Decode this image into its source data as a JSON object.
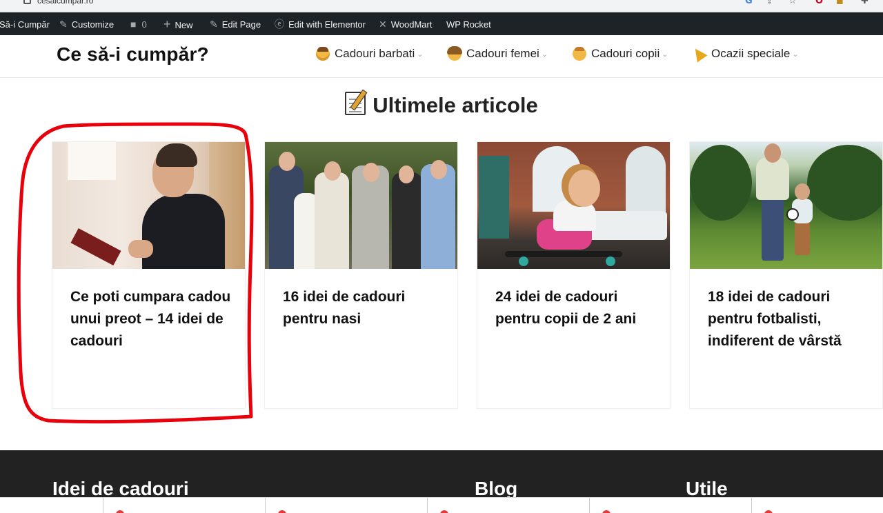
{
  "browser": {
    "url": "cesaicumpar.ro"
  },
  "adminbar": {
    "site_name": "Să-i Cumpăr",
    "customize": "Customize",
    "comments_count": "0",
    "new": "New",
    "edit_page": "Edit Page",
    "edit_elementor": "Edit with Elementor",
    "woodmart": "WoodMart",
    "wp_rocket": "WP Rocket"
  },
  "header": {
    "logo": "Ce să-i cumpăr?",
    "nav": [
      {
        "label": "Cadouri barbati",
        "icon": "man-emoji-icon"
      },
      {
        "label": "Cadouri femei",
        "icon": "woman-emoji-icon"
      },
      {
        "label": "Cadouri copii",
        "icon": "child-emoji-icon"
      },
      {
        "label": "Ocazii speciale",
        "icon": "party-popper-icon"
      }
    ]
  },
  "section": {
    "title": "Ultimele articole",
    "icon": "memo-icon"
  },
  "articles": [
    {
      "title": "Ce poti cumpara cadou unui preot – 14 idei de cadouri",
      "image": "priest-photo"
    },
    {
      "title": "16 idei de cadouri pentru nasi",
      "image": "baptism-group-photo"
    },
    {
      "title": "24 idei de cadouri pentru copii de 2 ani",
      "image": "child-skateboard-photo"
    },
    {
      "title": "18 idei de cadouri pentru fotbalisti, indiferent de vârstă",
      "image": "father-son-football-photo"
    }
  ],
  "footer": {
    "col1": "Idei de cadouri",
    "col2": "Blog",
    "col3": "Utile"
  },
  "colors": {
    "adminbar": "#1d2327",
    "footer": "#222222",
    "annotation": "#e8000b"
  }
}
